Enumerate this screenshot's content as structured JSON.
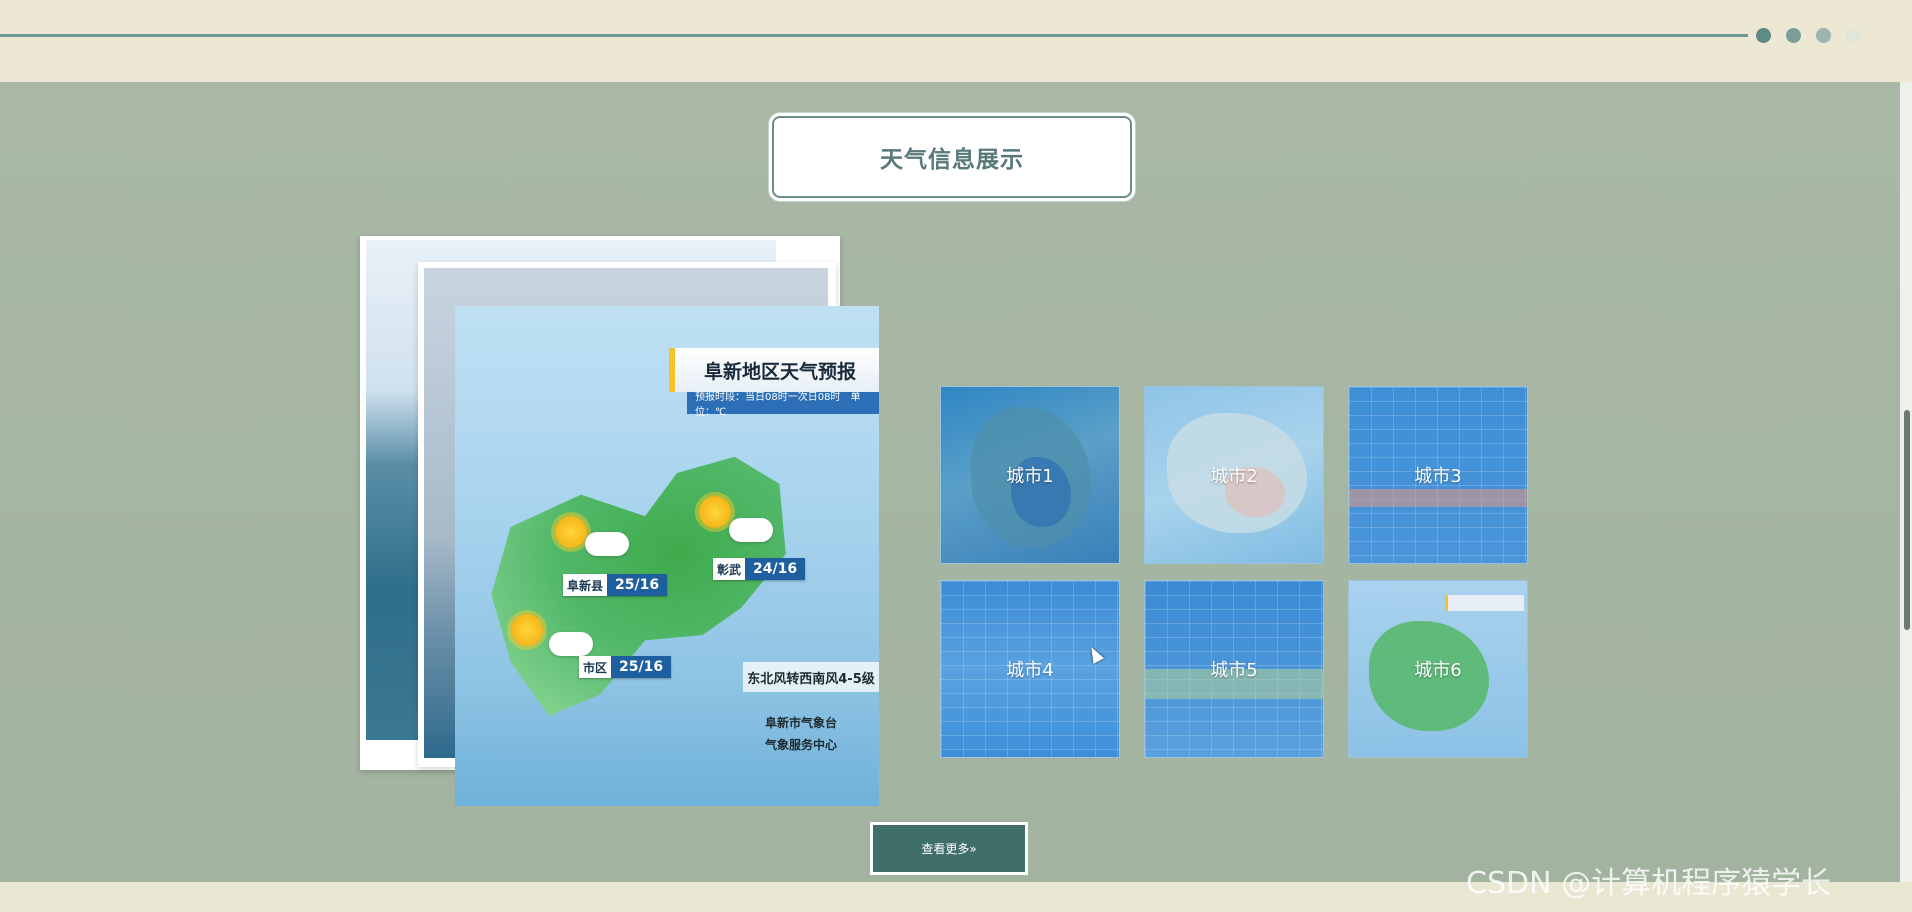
{
  "carousel": {
    "dots": [
      {
        "name": "carousel-dot-1",
        "color": "#5e8b87",
        "active": true
      },
      {
        "name": "carousel-dot-2",
        "color": "#7c9e9a",
        "active": false
      },
      {
        "name": "carousel-dot-3",
        "color": "#9bb5b1",
        "active": false
      },
      {
        "name": "carousel-dot-4",
        "color": "#e2e6d8",
        "active": false
      }
    ]
  },
  "section": {
    "title": "天气信息展示"
  },
  "featured": {
    "forecast_title": "阜新地区天气预报",
    "forecast_sub": "预报时段：当日08时一次日08时　单位：℃",
    "cities": [
      {
        "name": "阜新县",
        "temp": "25/16"
      },
      {
        "name": "彰武",
        "temp": "24/16"
      },
      {
        "name": "市区",
        "temp": "25/16"
      }
    ],
    "wind": "东北风转西南风4-5级",
    "station_line1": "阜新市气象台",
    "station_line2": "气象服务中心"
  },
  "grid": {
    "items": [
      {
        "label": "城市1"
      },
      {
        "label": "城市2"
      },
      {
        "label": "城市3"
      },
      {
        "label": "城市4"
      },
      {
        "label": "城市5"
      },
      {
        "label": "城市6"
      }
    ]
  },
  "more_button": {
    "label": "查看更多»"
  },
  "watermark": "CSDN @计算机程序猿学长",
  "colors": {
    "top_band": "#ece8d3",
    "background": "#a4b5a1",
    "accent": "#3f6e6a"
  }
}
